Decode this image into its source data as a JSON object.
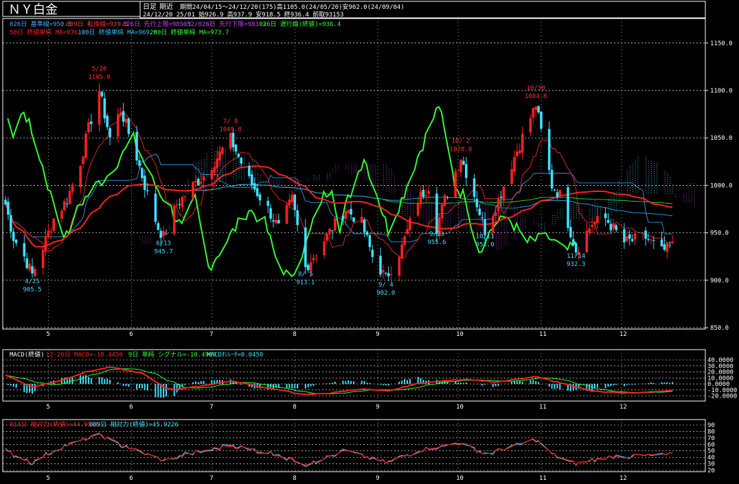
{
  "header": {
    "title": "ＮＹ白金",
    "period_type": "日足",
    "contract": "期近",
    "period_info": "期間24/04/15～24/12/20(175)高1105.0(24/05/20)安902.0(24/09/04)",
    "ohlc_info": "24/12/20 25/01 始926.9 高937.9 安918.5 終936.4 前取93153"
  },
  "legends": {
    "line1": [
      {
        "text": "026日 基準線=950.3",
        "color": "#3fa9ff"
      },
      {
        "text": "009日 転換線=939.3",
        "color": "#ff3030"
      },
      {
        "text": "026日 先行上限=985.3",
        "color": "#d040ff"
      },
      {
        "text": "052/026日 先行下限=983.3",
        "color": "#d040ff"
      },
      {
        "text": "026日 遅行線(終値)=936.4",
        "color": "#30ff30"
      }
    ],
    "line2": [
      {
        "text": "50日 終値単純 MA=976.0",
        "color": "#ff2020"
      },
      {
        "text": "100日 終値単純 MA=969.6",
        "color": "#30c0ff"
      },
      {
        "text": "200日 終値単純 MA=973.7",
        "color": "#30ff30"
      }
    ],
    "macd": [
      {
        "text": "MACD(終値)",
        "color": "#ffffff"
      },
      {
        "text": "12-26日 MACD=-10.4450",
        "color": "#ff2020"
      },
      {
        "text": "9日 単純 シグナル=-10.4900",
        "color": "#30ff30"
      },
      {
        "text": "MACDｵｼﾚｰﾀ=0.0450",
        "color": "#40e0ff"
      }
    ],
    "rsi": [
      {
        "text": "014日 相対力(終値)=44.9538",
        "color": "#ff2020"
      },
      {
        "text": "009日 相対力(終値)=45.9226",
        "color": "#40e0ff"
      }
    ]
  },
  "chart_data": [
    {
      "type": "candlestick",
      "title": "ＮＹ白金",
      "xlabel": "",
      "ylabel": "",
      "x_months": [
        "5",
        "6",
        "7",
        "8",
        "9",
        "10",
        "11",
        "12"
      ],
      "ylim": [
        850,
        1165
      ],
      "yticks": [
        850.0,
        900.0,
        950.0,
        1000.0,
        1050.0,
        1100.0,
        1150.0
      ],
      "close_anchors": [
        [
          "2024-04-15",
          980
        ],
        [
          "2024-04-18",
          945
        ],
        [
          "2024-04-22",
          925
        ],
        [
          "2024-04-25",
          906
        ],
        [
          "2024-04-29",
          935
        ],
        [
          "2024-05-03",
          965
        ],
        [
          "2024-05-08",
          985
        ],
        [
          "2024-05-13",
          1025
        ],
        [
          "2024-05-16",
          1060
        ],
        [
          "2024-05-20",
          1100
        ],
        [
          "2024-05-24",
          1050
        ],
        [
          "2024-05-28",
          1080
        ],
        [
          "2024-06-03",
          1030
        ],
        [
          "2024-06-07",
          990
        ],
        [
          "2024-06-11",
          955
        ],
        [
          "2024-06-13",
          946
        ],
        [
          "2024-06-18",
          980
        ],
        [
          "2024-06-24",
          1000
        ],
        [
          "2024-06-28",
          1010
        ],
        [
          "2024-07-08",
          1049
        ],
        [
          "2024-07-15",
          1005
        ],
        [
          "2024-07-22",
          975
        ],
        [
          "2024-07-26",
          955
        ],
        [
          "2024-07-31",
          985
        ],
        [
          "2024-08-05",
          913
        ],
        [
          "2024-08-09",
          930
        ],
        [
          "2024-08-15",
          955
        ],
        [
          "2024-08-20",
          975
        ],
        [
          "2024-08-26",
          960
        ],
        [
          "2024-08-30",
          925
        ],
        [
          "2024-09-04",
          902
        ],
        [
          "2024-09-10",
          935
        ],
        [
          "2024-09-16",
          985
        ],
        [
          "2024-09-20",
          1000
        ],
        [
          "2024-09-23",
          956
        ],
        [
          "2024-09-26",
          985
        ],
        [
          "2024-10-02",
          1030
        ],
        [
          "2024-10-07",
          990
        ],
        [
          "2024-10-11",
          953
        ],
        [
          "2024-10-16",
          985
        ],
        [
          "2024-10-22",
          1030
        ],
        [
          "2024-10-30",
          1085
        ],
        [
          "2024-11-05",
          1000
        ],
        [
          "2024-11-08",
          990
        ],
        [
          "2024-11-14",
          932
        ],
        [
          "2024-11-20",
          960
        ],
        [
          "2024-11-25",
          965
        ],
        [
          "2024-12-02",
          940
        ],
        [
          "2024-12-10",
          945
        ],
        [
          "2024-12-16",
          930
        ],
        [
          "2024-12-20",
          936
        ]
      ],
      "annotations": [
        {
          "date": "2024-04-25",
          "label": "4/25",
          "value": "905.5",
          "kind": "low"
        },
        {
          "date": "2024-05-20",
          "label": "5/20",
          "value": "1105.0",
          "kind": "high"
        },
        {
          "date": "2024-06-13",
          "label": "6/13",
          "value": "945.7",
          "kind": "low"
        },
        {
          "date": "2024-07-08",
          "label": "7/ 8",
          "value": "1049.8",
          "kind": "high"
        },
        {
          "date": "2024-08-05",
          "label": "8/ 5",
          "value": "913.1",
          "kind": "low"
        },
        {
          "date": "2024-09-04",
          "label": "9/ 4",
          "value": "902.0",
          "kind": "low"
        },
        {
          "date": "2024-09-23",
          "label": "9/23",
          "value": "955.6",
          "kind": "low"
        },
        {
          "date": "2024-10-02",
          "label": "10/ 2",
          "value": "1028.8",
          "kind": "high"
        },
        {
          "date": "2024-10-11",
          "label": "10/11",
          "value": "953.0",
          "kind": "low"
        },
        {
          "date": "2024-10-30",
          "label": "10/30",
          "value": "1084.8",
          "kind": "high"
        },
        {
          "date": "2024-11-14",
          "label": "11/14",
          "value": "932.3",
          "kind": "low"
        }
      ]
    },
    {
      "type": "line",
      "title": "MACD(終値)",
      "ylim": [
        -25,
        40
      ],
      "yticks": [
        "40.0000",
        "30.0000",
        "20.0000",
        "10.0000",
        "0.0000",
        "-10.0000",
        "-20.0000"
      ],
      "macd_anchors": [
        [
          "2024-04-15",
          15
        ],
        [
          "2024-04-25",
          -5
        ],
        [
          "2024-05-05",
          5
        ],
        [
          "2024-05-15",
          20
        ],
        [
          "2024-05-24",
          28
        ],
        [
          "2024-06-05",
          18
        ],
        [
          "2024-06-15",
          -10
        ],
        [
          "2024-06-25",
          -5
        ],
        [
          "2024-07-08",
          5
        ],
        [
          "2024-07-20",
          -5
        ],
        [
          "2024-08-05",
          -18
        ],
        [
          "2024-08-15",
          -15
        ],
        [
          "2024-08-25",
          -8
        ],
        [
          "2024-09-05",
          -12
        ],
        [
          "2024-09-15",
          0
        ],
        [
          "2024-09-25",
          5
        ],
        [
          "2024-10-05",
          8
        ],
        [
          "2024-10-15",
          3
        ],
        [
          "2024-10-30",
          12
        ],
        [
          "2024-11-10",
          0
        ],
        [
          "2024-11-20",
          -12
        ],
        [
          "2024-12-01",
          -15
        ],
        [
          "2024-12-10",
          -14
        ],
        [
          "2024-12-20",
          -10.445
        ]
      ]
    },
    {
      "type": "line",
      "title": "相対力",
      "ylim": [
        20,
        90
      ],
      "yticks": [
        "90",
        "80",
        "70",
        "60",
        "50",
        "40",
        "30",
        "20"
      ],
      "rsi_anchors": [
        [
          "2024-04-15",
          50
        ],
        [
          "2024-04-25",
          32
        ],
        [
          "2024-05-05",
          55
        ],
        [
          "2024-05-20",
          75
        ],
        [
          "2024-05-28",
          60
        ],
        [
          "2024-06-13",
          35
        ],
        [
          "2024-06-25",
          48
        ],
        [
          "2024-07-08",
          58
        ],
        [
          "2024-07-25",
          45
        ],
        [
          "2024-08-05",
          30
        ],
        [
          "2024-08-20",
          50
        ],
        [
          "2024-09-04",
          32
        ],
        [
          "2024-09-20",
          55
        ],
        [
          "2024-10-02",
          62
        ],
        [
          "2024-10-11",
          45
        ],
        [
          "2024-10-30",
          68
        ],
        [
          "2024-11-05",
          45
        ],
        [
          "2024-11-14",
          30
        ],
        [
          "2024-11-25",
          40
        ],
        [
          "2024-12-20",
          44.95
        ]
      ]
    }
  ]
}
